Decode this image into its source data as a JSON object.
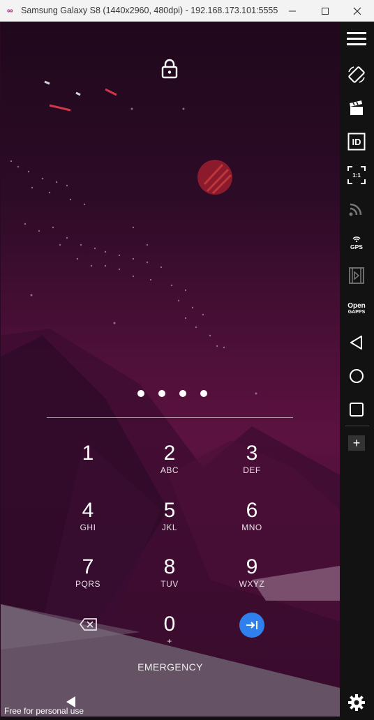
{
  "window": {
    "title": "Samsung Galaxy S8 (1440x2960, 480dpi) - 192.168.173.101:5555 -...",
    "app_icon": "∞",
    "minimize": "—",
    "maximize": "☐",
    "close": "✕"
  },
  "lockscreen": {
    "pin_dot_count": 4,
    "keys": [
      {
        "digit": "1",
        "letters": ""
      },
      {
        "digit": "2",
        "letters": "ABC"
      },
      {
        "digit": "3",
        "letters": "DEF"
      },
      {
        "digit": "4",
        "letters": "GHI"
      },
      {
        "digit": "5",
        "letters": "JKL"
      },
      {
        "digit": "6",
        "letters": "MNO"
      },
      {
        "digit": "7",
        "letters": "PQRS"
      },
      {
        "digit": "8",
        "letters": "TUV"
      },
      {
        "digit": "9",
        "letters": "WXYZ"
      },
      {
        "digit": "0",
        "letters": "+"
      }
    ],
    "emergency_label": "EMERGENCY",
    "accent_color": "#2f80ed"
  },
  "watermark": "Free for personal use",
  "toolbar": {
    "items": [
      {
        "name": "menu-icon"
      },
      {
        "name": "rotate-icon"
      },
      {
        "name": "capture-icon"
      },
      {
        "name": "device-id-icon",
        "label": "ID"
      },
      {
        "name": "pixel-perfect-icon",
        "label": "1:1"
      },
      {
        "name": "wifi-icon"
      },
      {
        "name": "gps-icon",
        "label": "GPS"
      },
      {
        "name": "media-icon"
      },
      {
        "name": "open-gapps-icon",
        "label": "Open GAPPS"
      },
      {
        "name": "back-icon"
      },
      {
        "name": "home-icon"
      },
      {
        "name": "recents-icon"
      },
      {
        "name": "add-icon",
        "label": "+"
      },
      {
        "name": "settings-icon"
      }
    ],
    "id_label": "ID",
    "pixel_label": "1:1",
    "gps_label": "GPS",
    "open_label": "Open",
    "gapps_label": "GAPPS",
    "plus_label": "+"
  }
}
